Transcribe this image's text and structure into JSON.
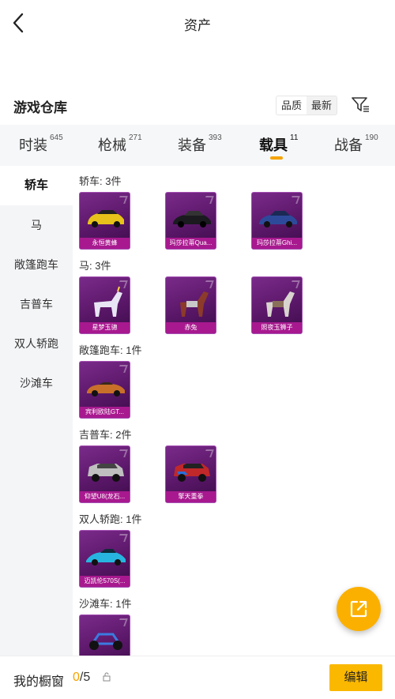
{
  "header": {
    "title": "资产"
  },
  "warehouse": {
    "title": "游戏仓库",
    "sort_options": [
      "品质",
      "最新"
    ]
  },
  "tabs": [
    {
      "label": "时装",
      "count": "645"
    },
    {
      "label": "枪械",
      "count": "271"
    },
    {
      "label": "装备",
      "count": "393"
    },
    {
      "label": "载具",
      "count": "11"
    },
    {
      "label": "战备",
      "count": "190"
    }
  ],
  "sidebar": {
    "items": [
      {
        "label": "轿车"
      },
      {
        "label": "马"
      },
      {
        "label": "敞篷跑车"
      },
      {
        "label": "吉普车"
      },
      {
        "label": "双人轿跑"
      },
      {
        "label": "沙滩车"
      }
    ]
  },
  "sections": [
    {
      "title": "轿车: 3件",
      "items": [
        "永恒黄蜂",
        "玛莎拉蒂Qua...",
        "玛莎拉蒂Ghi..."
      ]
    },
    {
      "title": "马: 3件",
      "items": [
        "星梦玉骢",
        "赤兔",
        "照夜玉狮子"
      ]
    },
    {
      "title": "敞篷跑车: 1件",
      "items": [
        "宾利欧陆GT..."
      ]
    },
    {
      "title": "吉普车: 2件",
      "items": [
        "仰望U8(龙石...",
        "擎天重拳"
      ]
    },
    {
      "title": "双人轿跑: 1件",
      "items": [
        "迈凯伦570S(..."
      ]
    },
    {
      "title": "沙滩车: 1件",
      "items": [
        ""
      ]
    }
  ],
  "showcase": {
    "label": "我的橱窗",
    "current": "0",
    "total": "/5",
    "edit_label": "编辑"
  },
  "colors": {
    "accent": "#f5a400",
    "rarity": "#a8198f"
  }
}
